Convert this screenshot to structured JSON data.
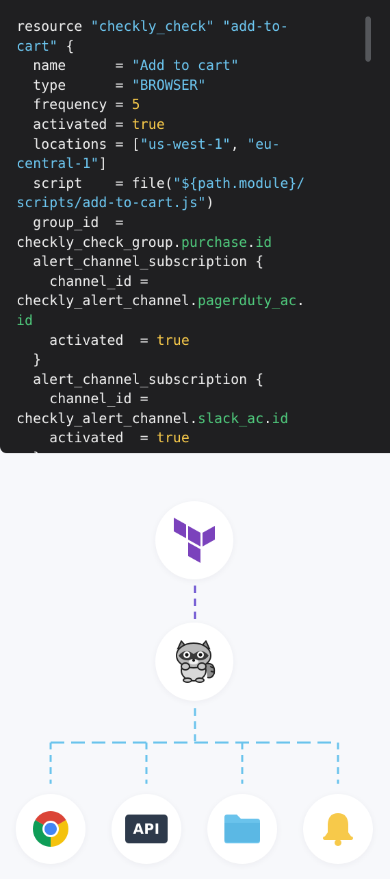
{
  "code": {
    "lines": [
      [
        {
          "t": "resource ",
          "c": ""
        },
        {
          "t": "\"checkly_check\"",
          "c": "s"
        },
        {
          "t": " ",
          "c": ""
        },
        {
          "t": "\"add-to-",
          "c": "s"
        }
      ],
      [
        {
          "t": "cart\"",
          "c": "s"
        },
        {
          "t": " {",
          "c": ""
        }
      ],
      [
        {
          "t": "  name      = ",
          "c": ""
        },
        {
          "t": "\"Add to cart\"",
          "c": "s"
        }
      ],
      [
        {
          "t": "  type      = ",
          "c": ""
        },
        {
          "t": "\"BROWSER\"",
          "c": "s"
        }
      ],
      [
        {
          "t": "  frequency = ",
          "c": ""
        },
        {
          "t": "5",
          "c": "n"
        }
      ],
      [
        {
          "t": "  activated = ",
          "c": ""
        },
        {
          "t": "true",
          "c": "n"
        }
      ],
      [
        {
          "t": "  locations = [",
          "c": ""
        },
        {
          "t": "\"us-west-1\"",
          "c": "s"
        },
        {
          "t": ", ",
          "c": ""
        },
        {
          "t": "\"eu-",
          "c": "s"
        }
      ],
      [
        {
          "t": "central-1\"",
          "c": "s"
        },
        {
          "t": "]",
          "c": ""
        }
      ],
      [
        {
          "t": "  script    = file(",
          "c": ""
        },
        {
          "t": "\"${path.module}/",
          "c": "s"
        }
      ],
      [
        {
          "t": "scripts/add-to-cart.js\"",
          "c": "s"
        },
        {
          "t": ")",
          "c": ""
        }
      ],
      [
        {
          "t": "  group_id  =",
          "c": ""
        }
      ],
      [
        {
          "t": "checkly_check_group.",
          "c": ""
        },
        {
          "t": "purchase",
          "c": "a"
        },
        {
          "t": ".",
          "c": ""
        },
        {
          "t": "id",
          "c": "a"
        }
      ],
      [
        {
          "t": "  alert_channel_subscription {",
          "c": ""
        }
      ],
      [
        {
          "t": "    channel_id =",
          "c": ""
        }
      ],
      [
        {
          "t": "checkly_alert_channel.",
          "c": ""
        },
        {
          "t": "pagerduty_ac",
          "c": "a"
        },
        {
          "t": ".",
          "c": ""
        }
      ],
      [
        {
          "t": "id",
          "c": "a"
        }
      ],
      [
        {
          "t": "    activated  = ",
          "c": ""
        },
        {
          "t": "true",
          "c": "n"
        }
      ],
      [
        {
          "t": "  }",
          "c": ""
        }
      ],
      [
        {
          "t": "  alert_channel_subscription {",
          "c": ""
        }
      ],
      [
        {
          "t": "    channel_id =",
          "c": ""
        }
      ],
      [
        {
          "t": "checkly_alert_channel.",
          "c": ""
        },
        {
          "t": "slack_ac",
          "c": "a"
        },
        {
          "t": ".",
          "c": ""
        },
        {
          "t": "id",
          "c": "a"
        }
      ],
      [
        {
          "t": "    activated  = ",
          "c": ""
        },
        {
          "t": "true",
          "c": "n"
        }
      ],
      [
        {
          "t": "  }",
          "c": ""
        }
      ]
    ]
  },
  "diagram": {
    "api_badge": "API",
    "icons": {
      "top": "terraform-logo-icon",
      "middle": "raccoon-mascot-icon",
      "leaves": [
        "chrome-browser-icon",
        "api-badge-icon",
        "folder-icon",
        "bell-icon"
      ]
    },
    "colors": {
      "terraform": "#7b42bc",
      "connector_top": "#6a4fd0",
      "connector_bottom": "#6ac3ec",
      "folder": "#6ac3ec",
      "bell": "#f7c94a",
      "api_badge_bg": "#2e3a4b"
    }
  }
}
